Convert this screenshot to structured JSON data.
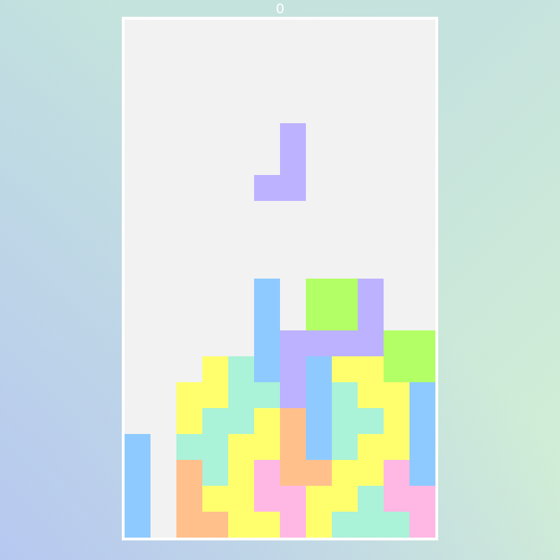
{
  "score": "0",
  "board": {
    "colors": {
      "B": "#8ecaff",
      "G": "#b3ff66",
      "P": "#bdb2ff",
      "Y": "#ffff6e",
      "M": "#aaf2d8",
      "O": "#ffc08c",
      "K": "#ffb8e4"
    },
    "rows": [
      "............",
      "............",
      "............",
      "............",
      "............",
      "............",
      "............",
      "............",
      "............",
      "............",
      ".....B.GGP..",
      ".....B.GGP..",
      ".....BPPPPGG",
      "...YMBPBYYGG",
      "..YYMMPBMYYB",
      "..YMMYOBMMYB",
      "B.MMYYOBMYYB",
      "B.OMYKOOYYKB",
      "B.OYYKKYYMKK",
      "B.OOYYKYMMMK"
    ]
  },
  "falling_piece": {
    "color": "#bdb2ff",
    "cells": [
      [
        6,
        4
      ],
      [
        6,
        5
      ],
      [
        6,
        6
      ],
      [
        5,
        6
      ]
    ]
  }
}
